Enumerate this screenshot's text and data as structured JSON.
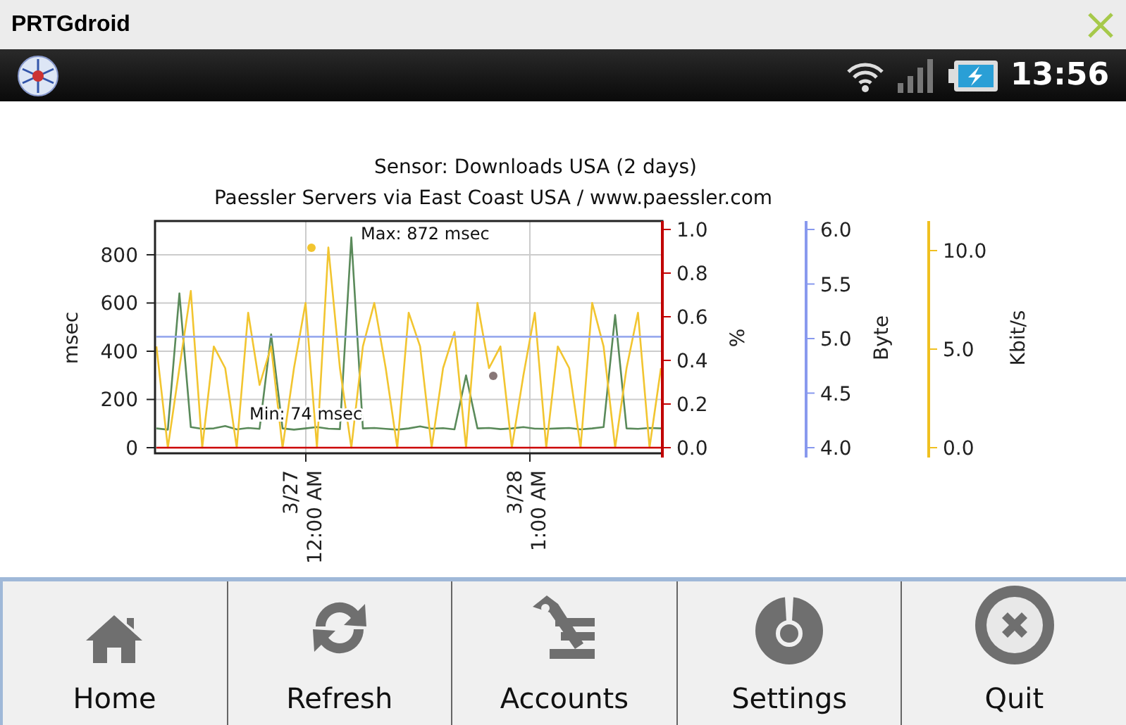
{
  "window": {
    "title": "PRTGdroid"
  },
  "status_bar": {
    "time": "13:56"
  },
  "chart": {
    "title": "Sensor: Downloads USA (2 days)",
    "subtitle": "Paessler Servers via East Coast USA / www.paessler.com",
    "max_label": "Max: 872 msec",
    "min_label": "Min: 74 msec",
    "chart_data": {
      "type": "line",
      "ylabel": "msec",
      "ylim": [
        0,
        940
      ],
      "yticks": [
        800,
        600,
        400,
        200,
        0
      ],
      "grid": true,
      "series": [
        {
          "color": "#f2c530",
          "values": [
            420,
            0,
            330,
            650,
            0,
            420,
            330,
            0,
            560,
            260,
            420,
            0,
            330,
            600,
            0,
            830,
            330,
            0,
            420,
            600,
            330,
            0,
            560,
            420,
            0,
            330,
            480,
            0,
            600,
            330,
            420,
            0,
            300,
            560,
            0,
            420,
            330,
            0,
            600,
            420,
            0,
            330,
            560,
            0,
            330
          ]
        },
        {
          "color": "#5a8a5a",
          "values": [
            80,
            75,
            640,
            85,
            78,
            80,
            90,
            76,
            82,
            78,
            470,
            80,
            75,
            80,
            85,
            79,
            77,
            872,
            80,
            82,
            78,
            75,
            80,
            88,
            79,
            81,
            76,
            300,
            80,
            82,
            77,
            80,
            85,
            79,
            78,
            80,
            82,
            76,
            80,
            85,
            550,
            80,
            78,
            82,
            80
          ]
        },
        {
          "color": "#99aaee",
          "values": [
            460,
            460,
            460,
            460,
            460,
            460,
            460,
            460,
            460,
            460,
            460,
            460,
            460,
            460,
            460,
            460,
            460,
            460,
            460,
            460,
            460,
            460,
            460,
            460,
            460,
            460,
            460,
            460,
            460,
            460,
            460,
            460,
            460,
            460,
            460,
            460,
            460,
            460,
            460,
            460,
            460,
            460,
            460,
            460,
            460
          ]
        },
        {
          "color": "#cc0000",
          "values": [
            0,
            0,
            0,
            0,
            0,
            0,
            0,
            0,
            0,
            0,
            0,
            0,
            0,
            0,
            0,
            0,
            0,
            0,
            0,
            0,
            0,
            0,
            0,
            0,
            0,
            0,
            0,
            0,
            0,
            0,
            0,
            0,
            0,
            0,
            0,
            0,
            0,
            0,
            0,
            0,
            0,
            0,
            0,
            0,
            0
          ]
        }
      ]
    },
    "axes": [
      {
        "label": "%",
        "color": "#c00000",
        "ticks": [
          "1.0",
          "0.8",
          "0.6",
          "0.4",
          "0.2",
          "0.0"
        ]
      },
      {
        "label": "Byte",
        "color": "#8899ee",
        "ticks": [
          "6.0",
          "5.5",
          "5.0",
          "4.5",
          "4.0"
        ]
      },
      {
        "label": "Kbit/s",
        "color": "#f0c020",
        "ticks": [
          "10.0",
          "5.0",
          "0.0"
        ]
      }
    ],
    "x_ticks": [
      {
        "date": "3/27",
        "time": "12:00 AM"
      },
      {
        "date": "3/28",
        "time": "1:00 AM"
      }
    ]
  },
  "menu": [
    {
      "label": "Home",
      "kind": "home"
    },
    {
      "label": "Refresh",
      "kind": "refresh"
    },
    {
      "label": "Accounts",
      "kind": "accounts"
    },
    {
      "label": "Settings",
      "kind": "settings"
    },
    {
      "label": "Quit",
      "kind": "quit"
    }
  ]
}
